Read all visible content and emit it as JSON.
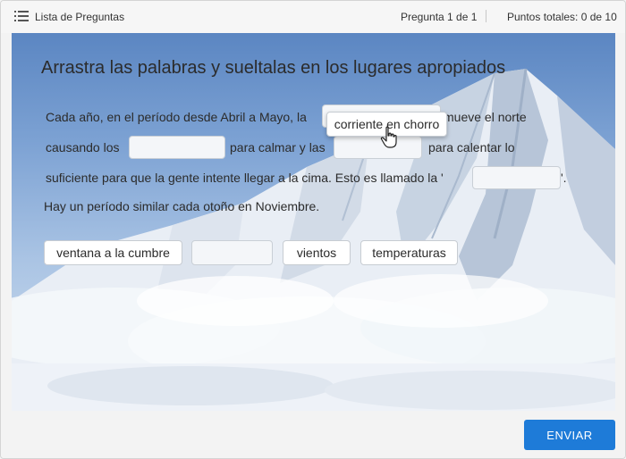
{
  "topbar": {
    "question_list_label": "Lista de Preguntas",
    "question_counter": "Pregunta 1 de 1",
    "score": "Puntos totales: 0 de 10"
  },
  "quiz": {
    "title": "Arrastra las palabras y sueltalas en los lugares apropiados",
    "sentence": {
      "part1": "Cada año, en el período desde Abril a Mayo, la",
      "part2": "mueve el norte",
      "part3": "causando los",
      "part4": "para calmar y las",
      "part5": "para calentar lo",
      "part6": "suficiente para que la gente intente llegar a la cima. Esto es llamado la '",
      "part7": "'.",
      "part8": "Hay un período similar cada otoño en Noviembre."
    },
    "dragging_word": "corriente en chorro",
    "word_bank": [
      "ventana a la cumbre",
      "vientos",
      "temperaturas"
    ]
  },
  "footer": {
    "submit_label": "ENVIAR"
  },
  "colors": {
    "accent": "#1e7bd8"
  }
}
